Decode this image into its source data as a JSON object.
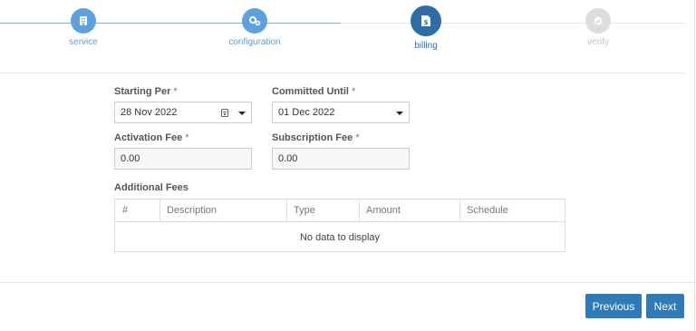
{
  "stepper": {
    "steps": [
      {
        "label": "service",
        "icon": "building-icon",
        "state": "done"
      },
      {
        "label": "configuration",
        "icon": "gears-icon",
        "state": "done"
      },
      {
        "label": "billing",
        "icon": "invoice-icon",
        "state": "active"
      },
      {
        "label": "verify",
        "icon": "check-circle-icon",
        "state": "pending"
      }
    ]
  },
  "form": {
    "starting_per": {
      "label": "Starting Per",
      "required_mark": "*",
      "value": "28 Nov 2022"
    },
    "committed_until": {
      "label": "Committed Until",
      "required_mark": "*",
      "value": "01 Dec 2022"
    },
    "activation_fee": {
      "label": "Activation Fee",
      "required_mark": "*",
      "value": "0.00"
    },
    "subscription_fee": {
      "label": "Subscription Fee",
      "required_mark": "*",
      "value": "0.00"
    }
  },
  "additional_fees": {
    "title": "Additional Fees",
    "columns": [
      "#",
      "Description",
      "Type",
      "Amount",
      "Schedule"
    ],
    "rows": [],
    "empty_text": "No data to display"
  },
  "footer": {
    "previous_label": "Previous",
    "next_label": "Next"
  },
  "colors": {
    "accent": "#2f7bb8",
    "done_circle": "#5da2e0",
    "active_circle": "#2f6da8",
    "pending_circle": "#dddddd",
    "step_line": "#7fb2dd"
  }
}
